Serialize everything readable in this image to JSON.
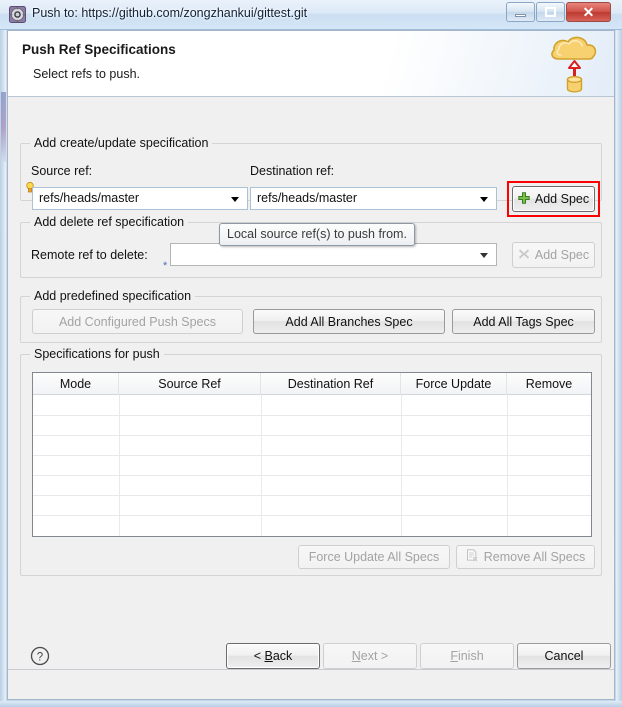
{
  "window": {
    "title": "Push to: https://github.com/zongzhankui/gittest.git",
    "icon": "push-gear-icon",
    "controls": {
      "minimize": "minimize-button",
      "maximize": "maximize-button",
      "close_glyph": "✕"
    }
  },
  "banner": {
    "title": "Push Ref Specifications",
    "subtitle": "Select refs to push.",
    "artwork": "cloud-push-graphic"
  },
  "groups": {
    "create_update": {
      "legend": "Add create/update specification",
      "source_label": "Source ref:",
      "source_value": "refs/heads/master",
      "destination_label": "Destination ref:",
      "destination_value": "refs/heads/master",
      "add_spec_label": "Add Spec",
      "add_spec_enabled": true,
      "highlight_color": "#ff0000"
    },
    "delete_ref": {
      "legend": "Add delete ref specification",
      "remote_label": "Remote ref to delete:",
      "remote_value": "",
      "add_spec_label": "Add Spec",
      "add_spec_enabled": false
    },
    "predefined": {
      "legend": "Add predefined specification",
      "buttons": [
        {
          "label": "Add Configured Push Specs",
          "enabled": false
        },
        {
          "label": "Add All Branches Spec",
          "enabled": true
        },
        {
          "label": "Add All Tags Spec",
          "enabled": true
        }
      ]
    },
    "specifications": {
      "legend": "Specifications for push",
      "columns": [
        "Mode",
        "Source Ref",
        "Destination Ref",
        "Force Update",
        "Remove"
      ],
      "rows": [],
      "row_count_visible": 7,
      "actions": [
        {
          "label": "Force Update All Specs",
          "enabled": false
        },
        {
          "label": "Remove All Specs",
          "enabled": false
        }
      ]
    }
  },
  "tooltip": {
    "text": "Local source ref(s) to push from."
  },
  "footer": {
    "help": "?",
    "buttons": [
      {
        "label": "< Back",
        "enabled": true
      },
      {
        "label": "Next >",
        "enabled": false
      },
      {
        "label": "Finish",
        "enabled": false
      },
      {
        "label": "Cancel",
        "enabled": true
      }
    ]
  }
}
